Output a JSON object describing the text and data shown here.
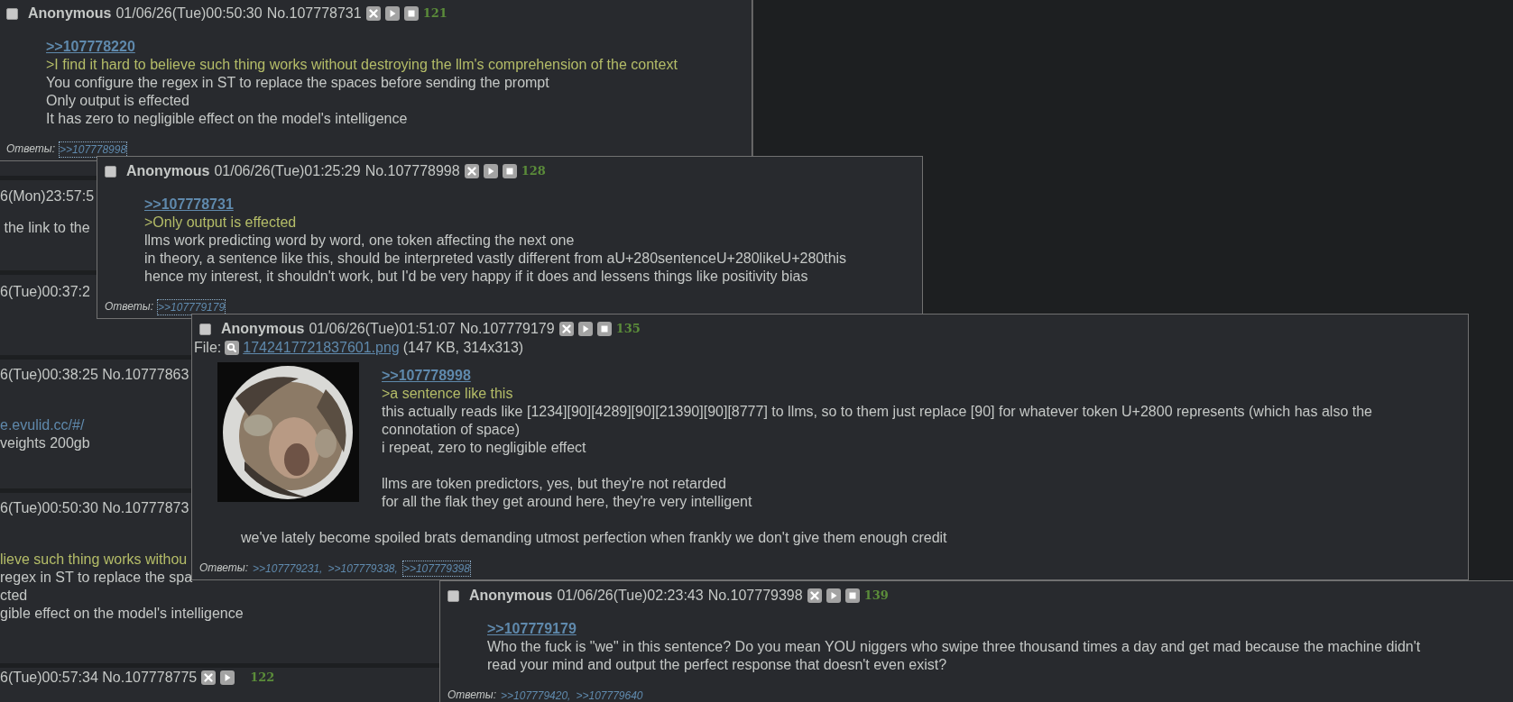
{
  "background_posts": [
    {
      "header": "6(Mon)23:57:5",
      "lines": [
        {
          "kind": "text",
          "text": " the link to the"
        }
      ]
    },
    {
      "header": "6(Tue)00:37:2"
    },
    {
      "header": "6(Tue)00:38:25 No.10777863",
      "lines": [
        {
          "kind": "link",
          "text": "e.evulid.cc/#/"
        },
        {
          "kind": "text",
          "text": "veights 200gb"
        }
      ]
    },
    {
      "header": "6(Tue)00:50:30 No.10777873",
      "lines": [
        {
          "kind": "quote",
          "text": "lieve such thing works withou"
        },
        {
          "kind": "text",
          "text": "regex in ST to replace the spa"
        },
        {
          "kind": "text",
          "text": "cted"
        },
        {
          "kind": "text",
          "text": "gible effect on the model's intelligence"
        }
      ]
    },
    {
      "header": "6(Tue)00:57:34 No.107778775",
      "count": "122"
    }
  ],
  "popups": [
    {
      "checked": false,
      "name": "Anonymous",
      "datetime": "01/06/26(Tue)00:50:30",
      "number": "No.107778731",
      "count": "121",
      "quote_link": ">>107778220",
      "lines": [
        {
          "kind": "quote",
          "text": ">I find it hard to believe such thing works without destroying the llm's comprehension of the context"
        },
        {
          "kind": "text",
          "text": "You configure the regex in ST to replace the spaces before sending the prompt"
        },
        {
          "kind": "text",
          "text": "Only output is effected"
        },
        {
          "kind": "text",
          "text": "It has zero to negligible effect on the model's intelligence"
        }
      ],
      "replies_label": "Ответы:",
      "replies": [
        {
          "text": ">>107778998",
          "selected": true
        }
      ]
    },
    {
      "checked": false,
      "name": "Anonymous",
      "datetime": "01/06/26(Tue)01:25:29",
      "number": "No.107778998",
      "count": "128",
      "quote_link": ">>107778731",
      "lines": [
        {
          "kind": "quote",
          "text": ">Only output is effected"
        },
        {
          "kind": "text",
          "text": "llms work predicting word by word, one token affecting the next one"
        },
        {
          "kind": "text",
          "text": "in theory, a sentence like this, should be interpreted vastly different from aU+280sentenceU+280likeU+280this"
        },
        {
          "kind": "text",
          "text": "hence my interest, it shouldn't work, but I'd be very happy if it does and lessens things like positivity bias"
        }
      ],
      "replies_label": "Ответы:",
      "replies": [
        {
          "text": ">>107779179",
          "selected": true
        }
      ]
    },
    {
      "checked": false,
      "name": "Anonymous",
      "datetime": "01/06/26(Tue)01:51:07",
      "number": "No.107779179",
      "count": "135",
      "file": {
        "label": "File:",
        "name": "1742417721837601.png",
        "info": "(147 KB, 314x313)",
        "kind": "picture"
      },
      "quote_link": ">>107778998",
      "lines": [
        {
          "kind": "quote",
          "text": ">a sentence like this"
        },
        {
          "kind": "text",
          "text": "this actually reads like [1234][90][4289][90][21390][90][8777] to llms, so to them just replace [90] for whatever token U+2800 represents (which has also the connotation of space)"
        },
        {
          "kind": "text",
          "text": "i repeat, zero to negligible effect"
        },
        {
          "kind": "break"
        },
        {
          "kind": "text",
          "text": "llms are token predictors, yes, but they're not retarded"
        },
        {
          "kind": "text",
          "text": "for all the flak they get around here, they're very intelligent"
        },
        {
          "kind": "break"
        },
        {
          "kind": "text",
          "text": "we've lately become spoiled brats demanding utmost perfection when frankly we don't give them enough credit"
        }
      ],
      "replies_label": "Ответы:",
      "replies": [
        {
          "text": ">>107779231,",
          "selected": false
        },
        {
          "text": ">>107779338,",
          "selected": false
        },
        {
          "text": ">>107779398",
          "selected": true
        }
      ]
    },
    {
      "checked": false,
      "name": "Anonymous",
      "datetime": "01/06/26(Tue)02:23:43",
      "number": "No.107779398",
      "count": "139",
      "quote_link": ">>107779179",
      "lines": [
        {
          "kind": "text",
          "text": "Who the fuck is \"we\" in this sentence? Do you mean YOU niggers who swipe three thousand times a day and get mad because the machine didn't read your mind and output the perfect response that doesn't even exist?"
        }
      ],
      "replies_label": "Ответы:",
      "replies": [
        {
          "text": ">>107779420,",
          "selected": false
        },
        {
          "text": ">>107779640",
          "selected": false
        }
      ]
    }
  ]
}
